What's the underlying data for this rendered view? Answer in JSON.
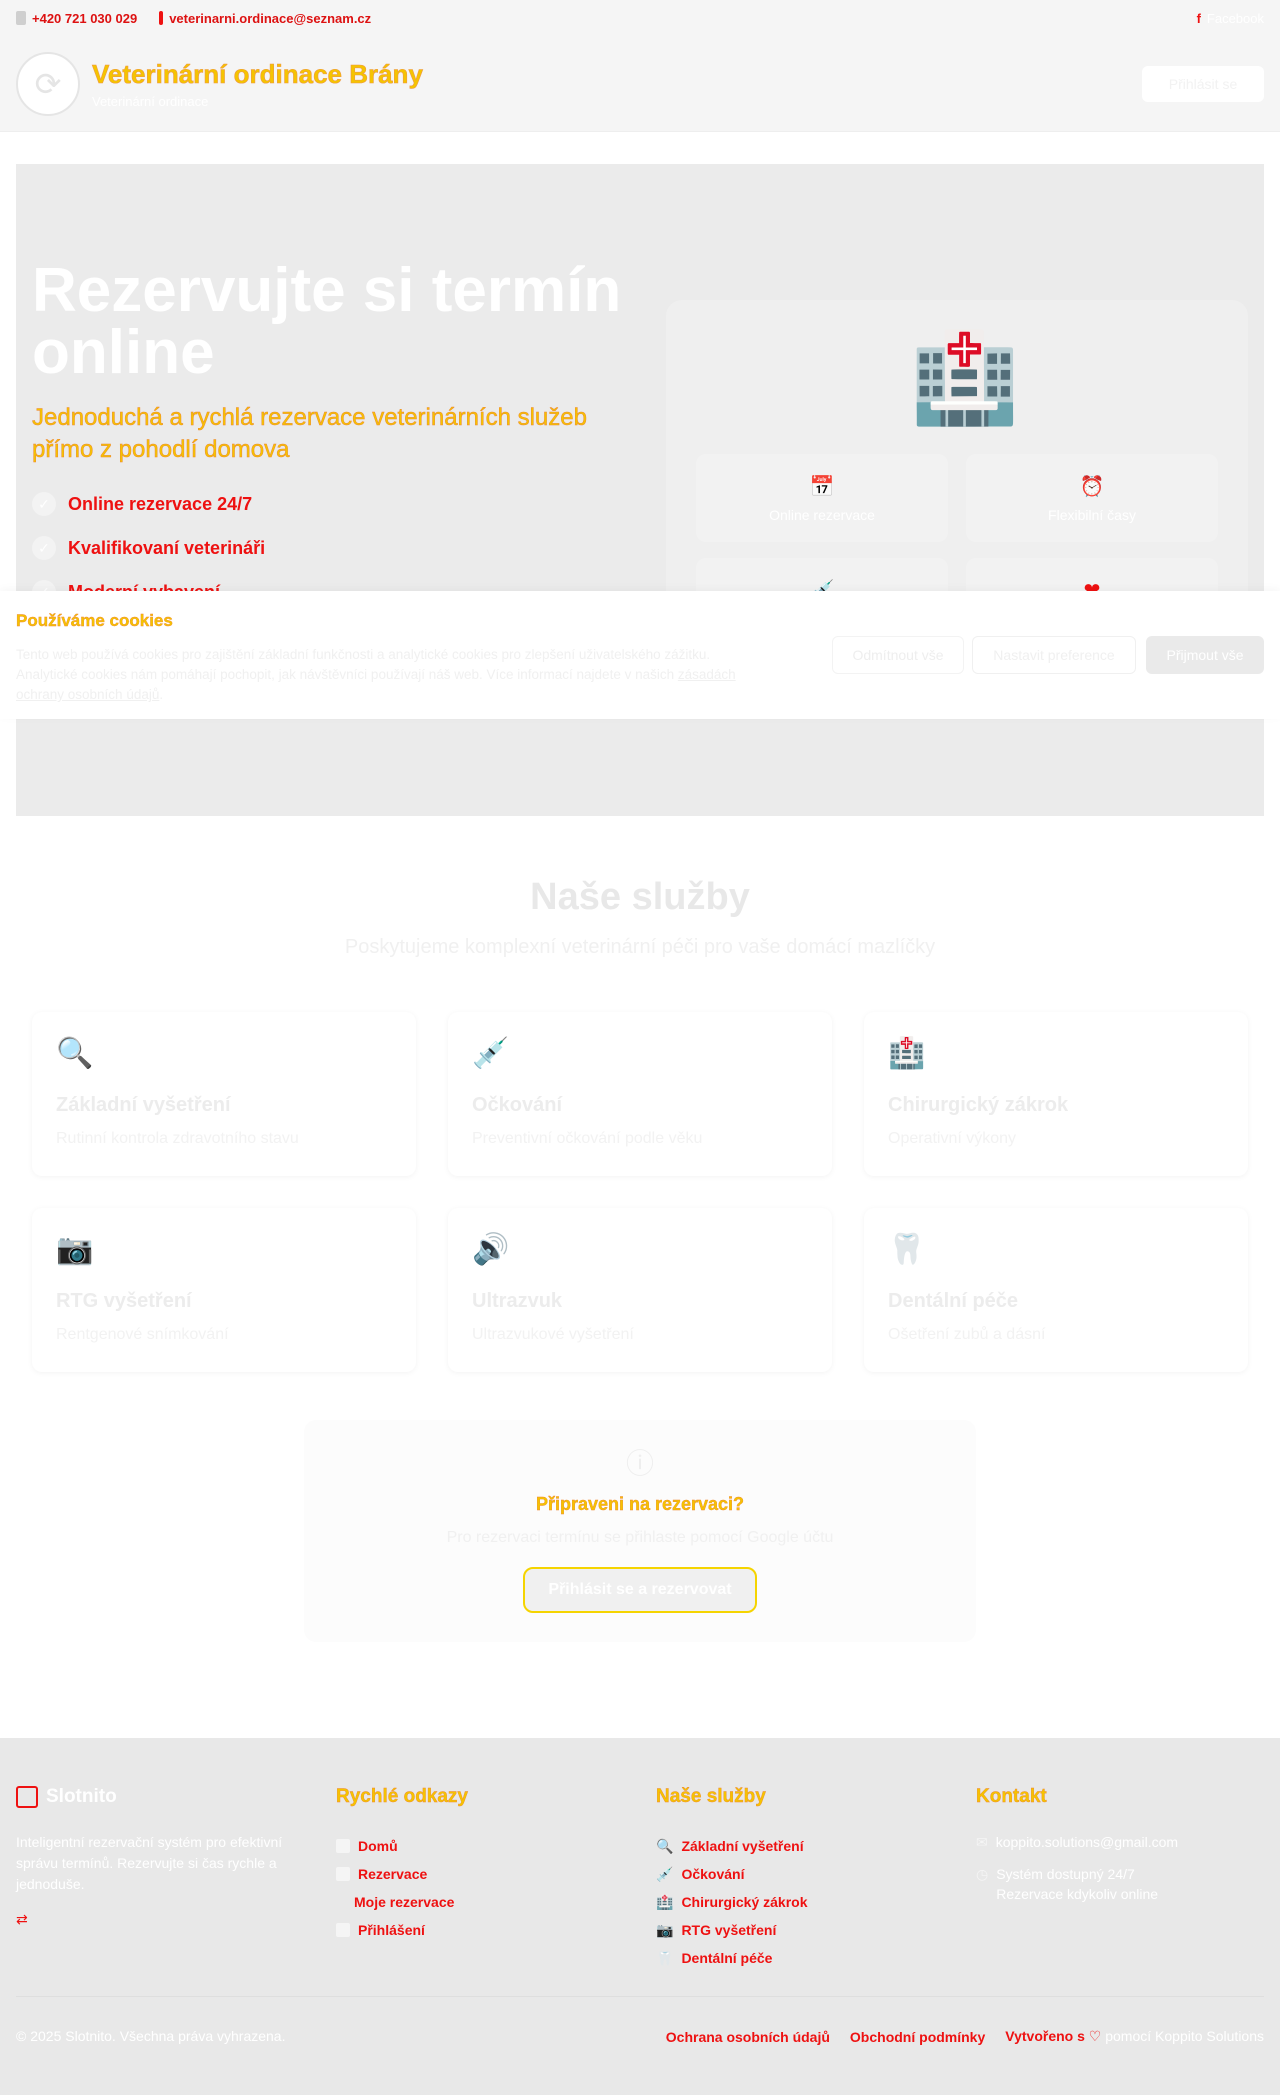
{
  "topbar": {
    "phone": "+420 721 030 029",
    "email": "veterinarni.ordinace@seznam.cz",
    "facebook": "Facebook"
  },
  "header": {
    "name": "Veterinární ordinace Brány",
    "subtitle": "Veterinární ordinace",
    "login": "Přihlásit se"
  },
  "hero": {
    "title": "Rezervujte si termín online",
    "lead": "Jednoduchá a rychlá rezervace veterinárních služeb přímo z pohodlí domova",
    "features": [
      "Online rezervace 24/7",
      "Kvalifikovaní veterináři",
      "Moderní vybavení"
    ],
    "card_items": [
      {
        "icon": "calendar-icon",
        "label": "Online rezervace"
      },
      {
        "icon": "clock-icon",
        "label": "Flexibilní časy"
      },
      {
        "icon": "syringe-icon",
        "label": ""
      },
      {
        "icon": "heart-icon",
        "label": ""
      }
    ]
  },
  "cookie": {
    "title": "Používáme cookies",
    "text": "Tento web používá cookies pro zajištění základní funkčnosti a analytické cookies pro zlepšení uživatelského zážitku. Analytické cookies nám pomáhají pochopit, jak návštěvníci používají náš web. Více informací najdete v našich",
    "link": "zásadách ochrany osobních údajů",
    "reject": "Odmítnout vše",
    "prefs": "Nastavit preference",
    "accept": "Přijmout vše"
  },
  "services": {
    "title": "Naše služby",
    "subtitle": "Poskytujeme komplexní veterinární péči pro vaše domácí mazlíčky",
    "items": [
      {
        "icon": "magnifier-icon",
        "name": "Základní vyšetření",
        "desc": "Rutinní kontrola zdravotního stavu"
      },
      {
        "icon": "syringe-icon",
        "name": "Očkování",
        "desc": "Preventivní očkování podle věku"
      },
      {
        "icon": "hospital-icon",
        "name": "Chirurgický zákrok",
        "desc": "Operativní výkony"
      },
      {
        "icon": "xray-icon",
        "name": "RTG vyšetření",
        "desc": "Rentgenové snímkování"
      },
      {
        "icon": "ultrasound-icon",
        "name": "Ultrazvuk",
        "desc": "Ultrazvukové vyšetření"
      },
      {
        "icon": "tooth-icon",
        "name": "Dentální péče",
        "desc": "Ošetření zubů a dásní"
      }
    ]
  },
  "reservation": {
    "title": "Připraveni na rezervaci?",
    "text": "Pro rezervaci termínu se přihlaste pomocí Google účtu",
    "button": "Přihlásit se a rezervovat"
  },
  "footer": {
    "brand": "Slotnito",
    "about": "Inteligentní rezervační systém pro efektivní správu termínů. Rezervujte si čas rychle a jednoduše.",
    "quick_title": "Rychlé odkazy",
    "quick_links": [
      "Domů",
      "Rezervace",
      "Moje rezervace",
      "Přihlášení"
    ],
    "services_title": "Naše služby",
    "services_links": [
      "Základní vyšetření",
      "Očkování",
      "Chirurgický zákrok",
      "RTG vyšetření",
      "Dentální péče"
    ],
    "contact_title": "Kontakt",
    "contact_email": "koppito.solutions@gmail.com",
    "contact_avail_1": "Systém dostupný 24/7",
    "contact_avail_2": "Rezervace kdykoliv online",
    "copyright": "© 2025 Slotnito. Všechna práva vyhrazena.",
    "privacy": "Ochrana osobních údajů",
    "terms": "Obchodní podmínky",
    "made_prefix": "Vytvořeno s",
    "made_suffix": "pomocí Koppito Solutions"
  }
}
